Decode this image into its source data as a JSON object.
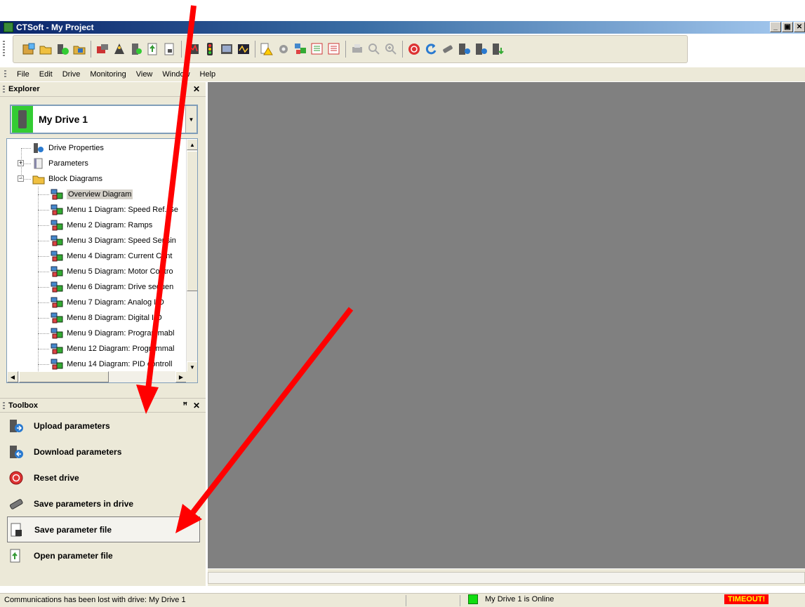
{
  "window": {
    "title": "CTSoft - My Project",
    "buttons": [
      "_",
      "▣",
      "✕"
    ]
  },
  "menu": [
    "File",
    "Edit",
    "Drive",
    "Monitoring",
    "View",
    "Window",
    "Help"
  ],
  "explorer": {
    "title": "Explorer",
    "close": "✕",
    "drive_selector": "My Drive 1",
    "tree": [
      {
        "label": "Drive Properties",
        "icon": "drive-properties-icon"
      },
      {
        "label": "Parameters",
        "icon": "parameters-book-icon",
        "expander": "+"
      },
      {
        "label": "Block Diagrams",
        "icon": "folder-icon",
        "expander": "−"
      },
      {
        "label": "Overview Diagram",
        "icon": "block-diagram-icon",
        "selected": true
      },
      {
        "label": "Menu 1 Diagram: Speed Ref. Se",
        "icon": "block-diagram-icon"
      },
      {
        "label": "Menu 2 Diagram: Ramps",
        "icon": "block-diagram-icon"
      },
      {
        "label": "Menu 3 Diagram: Speed Sensin",
        "icon": "block-diagram-icon"
      },
      {
        "label": "Menu 4 Diagram: Current Cont",
        "icon": "block-diagram-icon"
      },
      {
        "label": "Menu 5 Diagram: Motor Contro",
        "icon": "block-diagram-icon"
      },
      {
        "label": "Menu 6 Diagram: Drive sequen",
        "icon": "block-diagram-icon"
      },
      {
        "label": "Menu 7 Diagram: Analog I/O",
        "icon": "block-diagram-icon"
      },
      {
        "label": "Menu 8 Diagram: Digital I/O",
        "icon": "block-diagram-icon"
      },
      {
        "label": "Menu 9 Diagram: Programmabl",
        "icon": "block-diagram-icon"
      },
      {
        "label": "Menu 12 Diagram: Programmal",
        "icon": "block-diagram-icon"
      },
      {
        "label": "Menu 14 Diagram: PID controll",
        "icon": "block-diagram-icon"
      }
    ]
  },
  "toolbox": {
    "title": "Toolbox",
    "pin": "Ȩ",
    "close": "✕",
    "items": [
      {
        "label": "Upload parameters",
        "icon": "upload-parameters-icon"
      },
      {
        "label": "Download parameters",
        "icon": "download-parameters-icon"
      },
      {
        "label": "Reset drive",
        "icon": "reset-drive-icon"
      },
      {
        "label": "Save parameters in drive",
        "icon": "save-in-drive-icon"
      },
      {
        "label": "Save parameter file",
        "icon": "save-file-icon",
        "active": true
      },
      {
        "label": "Open parameter file",
        "icon": "open-file-icon"
      }
    ]
  },
  "status": {
    "message": "Communications has been lost with drive: My Drive 1",
    "online": "My Drive 1 is Online",
    "timeout": "TIMEOUT!"
  },
  "colors": {
    "annotation_arrow": "#ff0000",
    "online_indicator": "#11dd11",
    "workspace": "#808080",
    "timeout_bg": "#ff0000",
    "timeout_text": "#ffff00"
  }
}
